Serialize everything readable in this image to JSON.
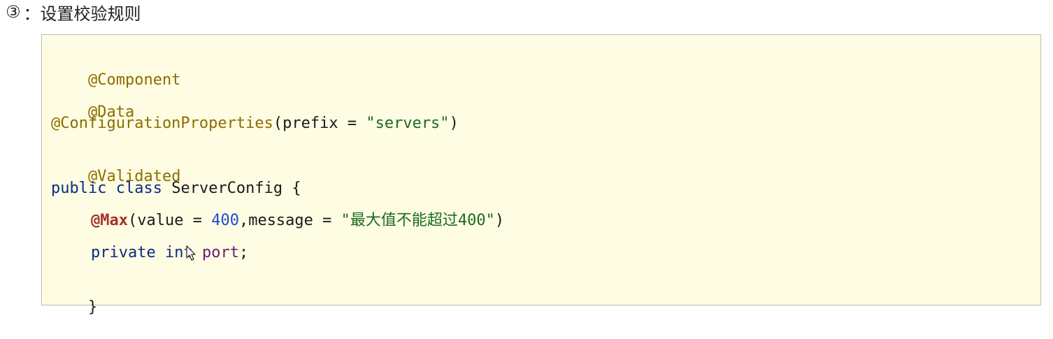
{
  "heading": {
    "number": "③",
    "text": "：设置校验规则"
  },
  "code": {
    "line1": {
      "annotation": "@Component"
    },
    "line2": {
      "annotation": "@Data"
    },
    "line3": {
      "annotation": "@ConfigurationProperties",
      "open": "(prefix = ",
      "string": "\"servers\"",
      "close": ")"
    },
    "line4": {
      "annotation": "@Validated"
    },
    "line5": {
      "kw1": "public",
      "kw2": "class",
      "name": " ServerConfig {"
    },
    "line6": {
      "annotation": "@Max",
      "part1": "(value = ",
      "number": "400",
      "part2": ",message = ",
      "string": "\"最大值不能超过400\"",
      "close": ")"
    },
    "line7": {
      "kw1": "private",
      "kw2": "int",
      "field": "port",
      "end": ";"
    },
    "line8": {
      "text": "}"
    }
  },
  "colors": {
    "code_background": "#fefce2",
    "annotation": "#8b6d00",
    "keyword": "#0b2a86",
    "string": "#1d6a22",
    "number": "#1d4bd1"
  },
  "icons": {
    "cursor": "mouse-pointer-icon"
  }
}
